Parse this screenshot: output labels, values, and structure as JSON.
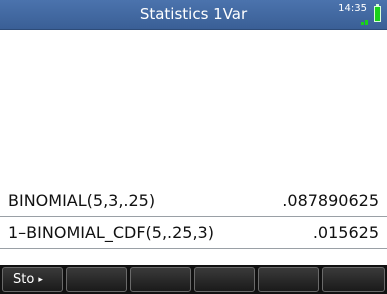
{
  "titlebar": {
    "title": "Statistics 1Var",
    "clock": "14:35",
    "battery_icon": "battery-icon",
    "signal_icon": "signal-icon",
    "accent_color": "#4b73ad"
  },
  "history": [
    {
      "expression": "BINOMIAL(5,3,.25)",
      "result": ".087890625"
    },
    {
      "expression": "1–BINOMIAL_CDF(5,.25,3)",
      "result": ".015625"
    }
  ],
  "menu": {
    "sto_label": "Sto",
    "sto_arrow": "▸",
    "empty_keys": [
      "",
      "",
      "",
      "",
      ""
    ]
  }
}
